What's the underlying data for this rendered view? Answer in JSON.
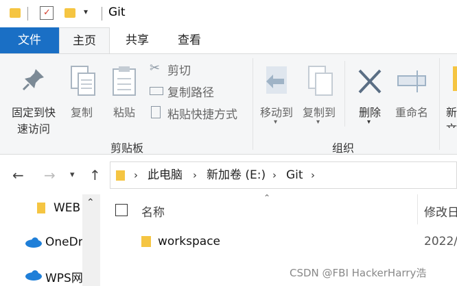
{
  "window": {
    "title": "Git"
  },
  "tabs": [
    {
      "label": "文件"
    },
    {
      "label": "主页"
    },
    {
      "label": "共享"
    },
    {
      "label": "查看"
    }
  ],
  "ribbon": {
    "pin": {
      "line1": "固定到快",
      "line2": "速访问"
    },
    "copy": "复制",
    "paste": "粘贴",
    "cut": "剪切",
    "copy_path": "复制路径",
    "paste_shortcut": "粘贴快捷方式",
    "clipboard_group": "剪贴板",
    "move_to": "移动到",
    "copy_to": "复制到",
    "delete": "删除",
    "rename": "重命名",
    "new_partial": {
      "line1": "新",
      "line2": "文"
    },
    "organize_group": "组织"
  },
  "address": {
    "crumbs": [
      "此电脑",
      "新加卷 (E:)",
      "Git"
    ]
  },
  "sidebar": {
    "items": [
      {
        "label": "WEB"
      },
      {
        "label": "OneDr"
      },
      {
        "label": "WPS网"
      }
    ]
  },
  "list": {
    "columns": {
      "name": "名称",
      "modified": "修改日"
    },
    "rows": [
      {
        "name": "workspace",
        "modified": "2022/"
      }
    ]
  },
  "watermark": "CSDN @FBI HackerHarry浩",
  "colors": {
    "file_tab": "#1a6fc5",
    "folder": "#f5c542",
    "ribbon_bg": "#f5f6f7",
    "onedrive": "#1f7fd8"
  }
}
